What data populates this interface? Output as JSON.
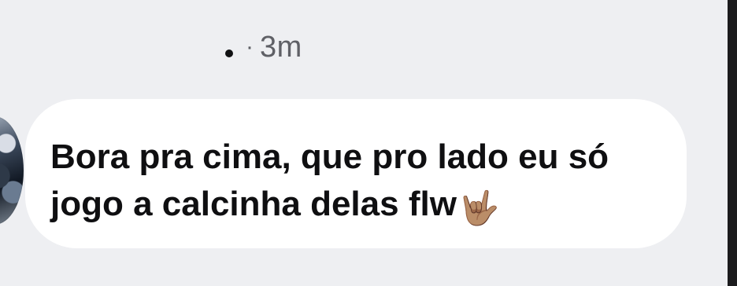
{
  "message_meta": {
    "time_ago": "3m",
    "separator": "·"
  },
  "message": {
    "line1": "Bora pra cima, que pro lado eu só",
    "line2": "jogo a calcinha delas  flw",
    "emoji": "🤟🏽"
  },
  "icons": {
    "status_dot": "status-dot-icon",
    "sender_avatar": "avatar"
  }
}
